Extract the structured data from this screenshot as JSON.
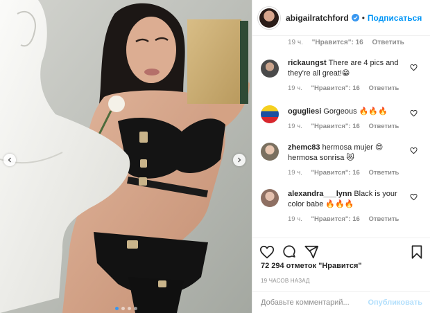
{
  "post": {
    "image_alt": "Photo post",
    "carousel_dots": 4,
    "active_dot": 0
  },
  "header": {
    "username": "abigailratchford",
    "separator": "•",
    "follow_label": "Подписаться",
    "verified_icon": "verified-badge-icon"
  },
  "comments": {
    "top_meta": {
      "time": "19 ч.",
      "likes": "\"Нравится\": 16",
      "reply": "Ответить"
    },
    "items": [
      {
        "username": "rickaungst",
        "text": "There are 4 pics and they're all great!😁",
        "time": "19 ч.",
        "likes": "\"Нравится\": 16",
        "reply": "Ответить",
        "avatar_color": "#5a5a5a"
      },
      {
        "username": "ogugliesi",
        "text": "Gorgeous 🔥🔥🔥",
        "time": "19 ч.",
        "likes": "\"Нравится\": 16",
        "reply": "Ответить",
        "avatar_color": "#f2c230"
      },
      {
        "username": "zhemc83",
        "text": "hermosa mujer 😍 hermosa sonrisa 😻",
        "time": "19 ч.",
        "likes": "\"Нравится\": 16",
        "reply": "Ответить",
        "avatar_color": "#7a7060"
      },
      {
        "username": "alexandra___lynn",
        "text": "Black is your color babe 🔥🔥🔥",
        "time": "19 ч.",
        "likes": "\"Нравится\": 16",
        "reply": "Ответить",
        "avatar_color": "#b89a8a"
      }
    ]
  },
  "actions": {
    "like_icon": "heart-icon",
    "comment_icon": "comment-icon",
    "share_icon": "share-icon",
    "save_icon": "bookmark-icon"
  },
  "likes": {
    "count": "72 294",
    "label": "отметок \"Нравится\""
  },
  "timestamp": "19 ЧАСОВ НАЗАД",
  "add_comment": {
    "placeholder": "Добавьте комментарий...",
    "post_label": "Опубликовать"
  },
  "colors": {
    "accent": "#0095f6",
    "muted": "#8e8e8e",
    "post_disabled": "#b2dffc",
    "carousel_active": "#3897f0"
  }
}
